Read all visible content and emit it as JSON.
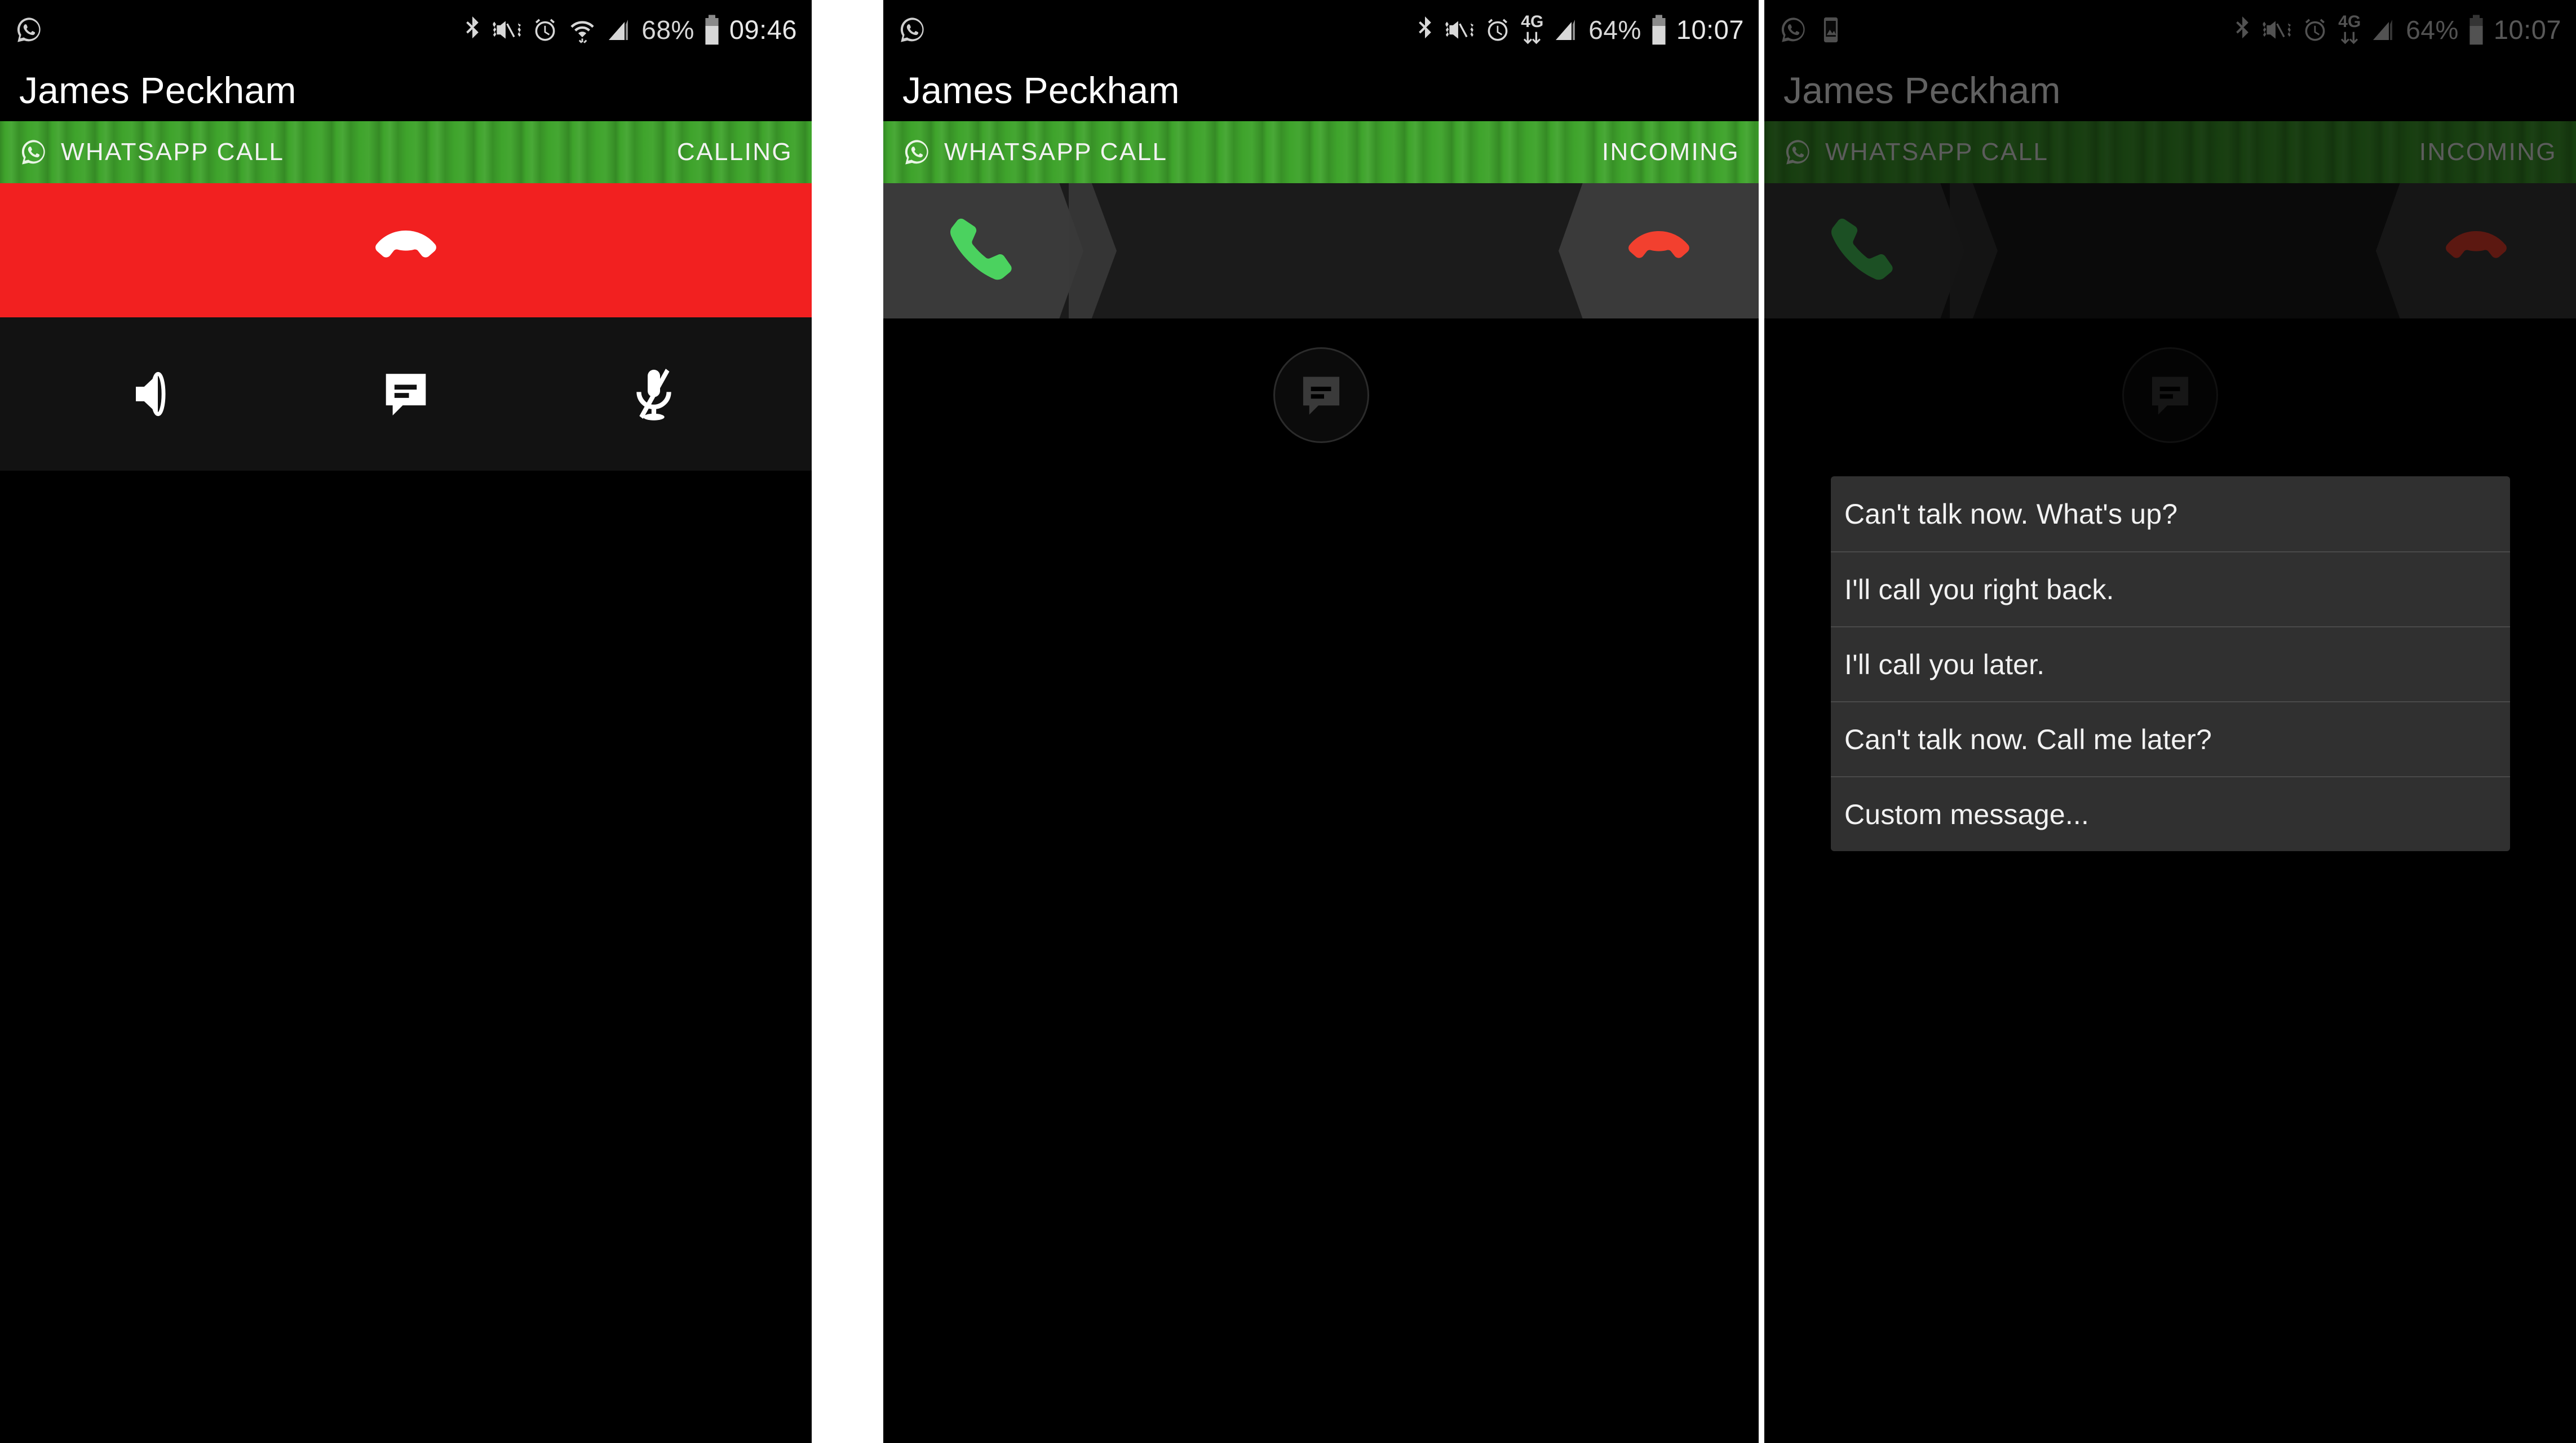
{
  "contact": {
    "name": "James Peckham"
  },
  "panels": [
    {
      "id": "outgoing-call",
      "status_bar": {
        "left_icons": [
          "whatsapp-icon"
        ],
        "right_icons": [
          "bluetooth-icon",
          "mute-vibrate-icon",
          "alarm-icon",
          "wifi-icon",
          "signal-icon"
        ],
        "network_label": "",
        "battery_percent": "68%",
        "clock": "09:46"
      },
      "header": {
        "name": "James Peckham"
      },
      "call_bar": {
        "icon": "whatsapp-icon",
        "label": "WHATSAPP CALL",
        "status": "CALLING"
      },
      "bottom": {
        "type": "in-call-controls",
        "end_call": {
          "icon": "hangup-icon",
          "color": "#f22020"
        },
        "controls": [
          {
            "icon": "speaker-icon",
            "name": "speaker-button"
          },
          {
            "icon": "message-icon",
            "name": "message-button"
          },
          {
            "icon": "mic-muted-icon",
            "name": "mute-button"
          }
        ]
      }
    },
    {
      "id": "incoming-call",
      "status_bar": {
        "left_icons": [
          "whatsapp-icon"
        ],
        "right_icons": [
          "bluetooth-icon",
          "mute-vibrate-icon",
          "alarm-icon",
          "data-icon",
          "signal-icon"
        ],
        "network_label": "4G",
        "battery_percent": "64%",
        "clock": "10:07"
      },
      "header": {
        "name": "James Peckham"
      },
      "call_bar": {
        "icon": "whatsapp-icon",
        "label": "WHATSAPP CALL",
        "status": "INCOMING"
      },
      "bottom": {
        "type": "answer-decline",
        "answer": {
          "icon": "phone-handset-icon",
          "color": "#4bd25f"
        },
        "decline": {
          "icon": "hangup-icon",
          "color": "#f2402f"
        },
        "message_button": {
          "icon": "message-icon"
        }
      }
    },
    {
      "id": "incoming-call-quick-reply",
      "dimmed": true,
      "status_bar": {
        "left_icons": [
          "whatsapp-icon",
          "screenshot-icon"
        ],
        "right_icons": [
          "bluetooth-icon",
          "mute-vibrate-icon",
          "alarm-icon",
          "data-icon",
          "signal-icon"
        ],
        "network_label": "4G",
        "battery_percent": "64%",
        "clock": "10:07"
      },
      "header": {
        "name": "James Peckham"
      },
      "call_bar": {
        "icon": "whatsapp-icon",
        "label": "WHATSAPP CALL",
        "status": "INCOMING"
      },
      "quick_reply_menu": {
        "items": [
          "Can't talk now. What's up?",
          "I'll call you right back.",
          "I'll call you later.",
          "Can't talk now. Call me later?",
          "Custom message..."
        ]
      },
      "bottom": {
        "type": "answer-decline",
        "answer": {
          "icon": "phone-handset-icon",
          "color": "#2d7a36"
        },
        "decline": {
          "icon": "hangup-icon",
          "color": "#9e2a22"
        },
        "message_button": {
          "icon": "message-icon"
        }
      }
    }
  ],
  "colors": {
    "whatsapp_green": "#3fa42c",
    "end_call_red": "#f22020",
    "answer_green": "#4bd25f",
    "decline_red": "#f2402f",
    "menu_background": "#303030"
  }
}
